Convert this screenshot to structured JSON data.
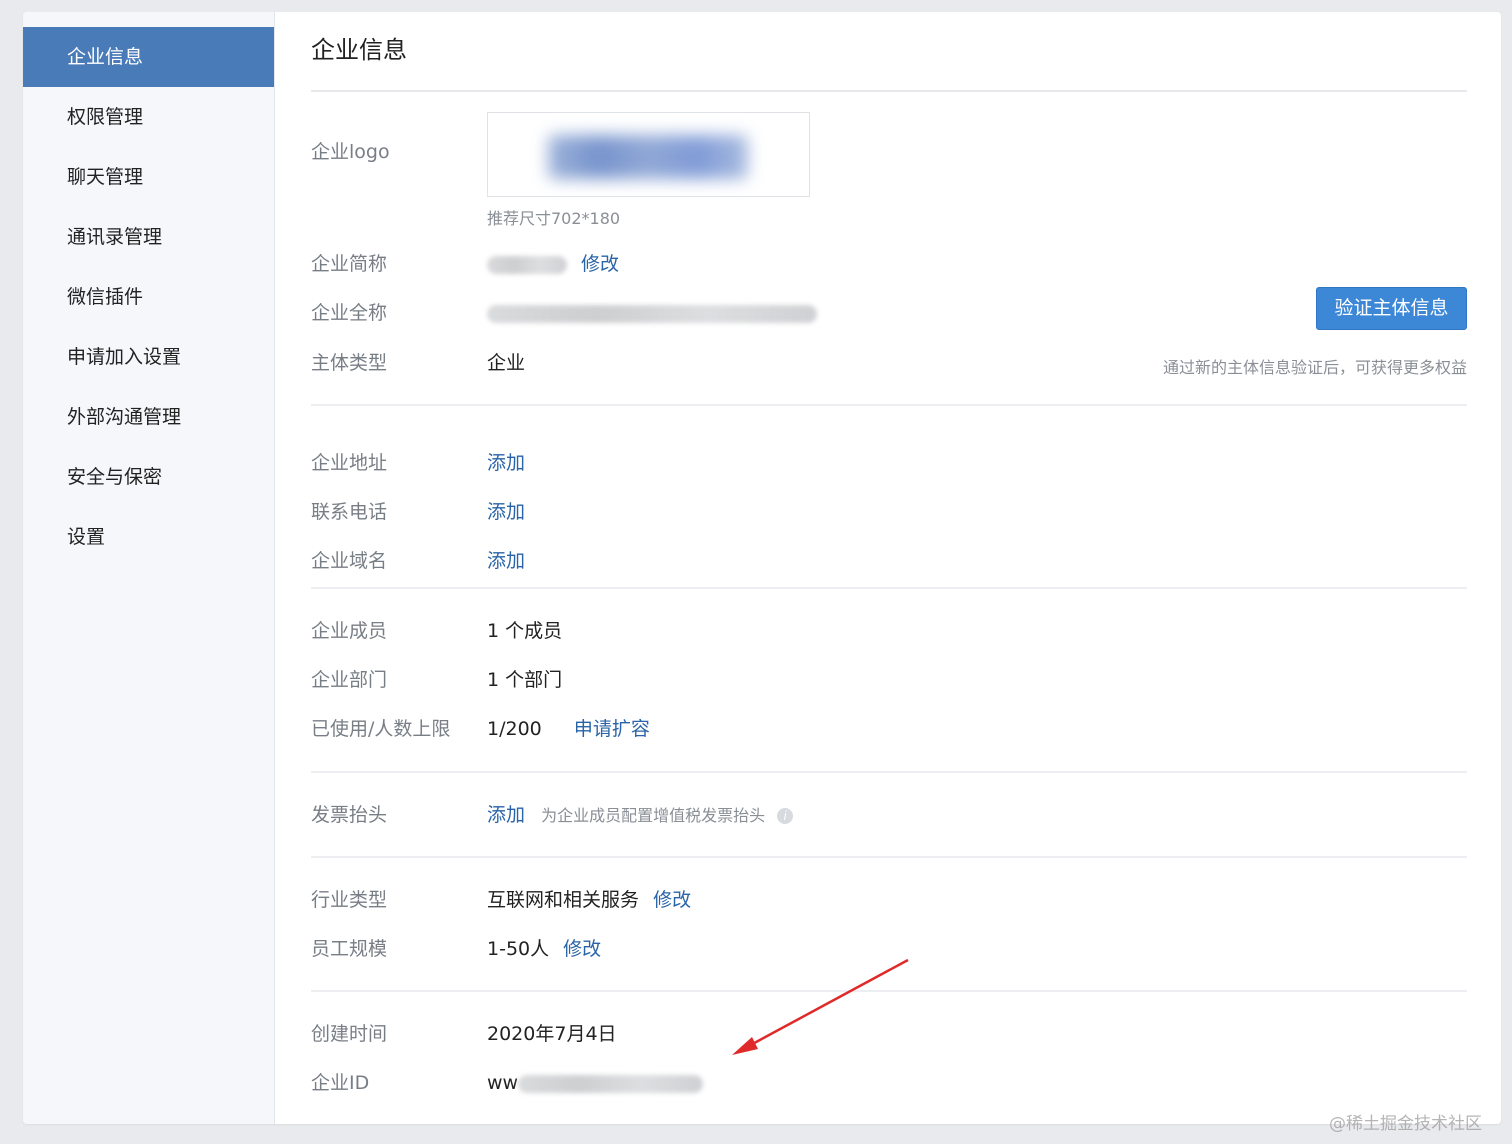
{
  "sidebar": {
    "items": [
      {
        "label": "企业信息"
      },
      {
        "label": "权限管理"
      },
      {
        "label": "聊天管理"
      },
      {
        "label": "通讯录管理"
      },
      {
        "label": "微信插件"
      },
      {
        "label": "申请加入设置"
      },
      {
        "label": "外部沟通管理"
      },
      {
        "label": "安全与保密"
      },
      {
        "label": "设置"
      }
    ]
  },
  "main": {
    "title": "企业信息",
    "logo": {
      "label": "企业logo",
      "hint": "推荐尺寸702*180"
    },
    "short_name": {
      "label": "企业简称",
      "action": "修改"
    },
    "full_name": {
      "label": "企业全称"
    },
    "entity_type": {
      "label": "主体类型",
      "value": "企业"
    },
    "verify": {
      "button": "验证主体信息",
      "note": "通过新的主体信息验证后，可获得更多权益"
    },
    "address": {
      "label": "企业地址",
      "action": "添加"
    },
    "phone": {
      "label": "联系电话",
      "action": "添加"
    },
    "domain": {
      "label": "企业域名",
      "action": "添加"
    },
    "members": {
      "label": "企业成员",
      "value": "1 个成员"
    },
    "departments": {
      "label": "企业部门",
      "value": "1 个部门"
    },
    "capacity": {
      "label": "已使用/人数上限",
      "value": "1/200",
      "action": "申请扩容"
    },
    "invoice": {
      "label": "发票抬头",
      "action": "添加",
      "note": "为企业成员配置增值税发票抬头"
    },
    "industry": {
      "label": "行业类型",
      "value": "互联网和相关服务",
      "action": "修改"
    },
    "staff_size": {
      "label": "员工规模",
      "value": "1-50人",
      "action": "修改"
    },
    "created": {
      "label": "创建时间",
      "value": "2020年7月4日"
    },
    "corp_id": {
      "label": "企业ID",
      "value_prefix": "ww"
    }
  },
  "watermark": "@稀土掘金技术社区",
  "colors": {
    "active_nav": "#4a7bb9",
    "link": "#2a64a8",
    "button": "#3c87d6",
    "arrow": "#e02a2a"
  }
}
